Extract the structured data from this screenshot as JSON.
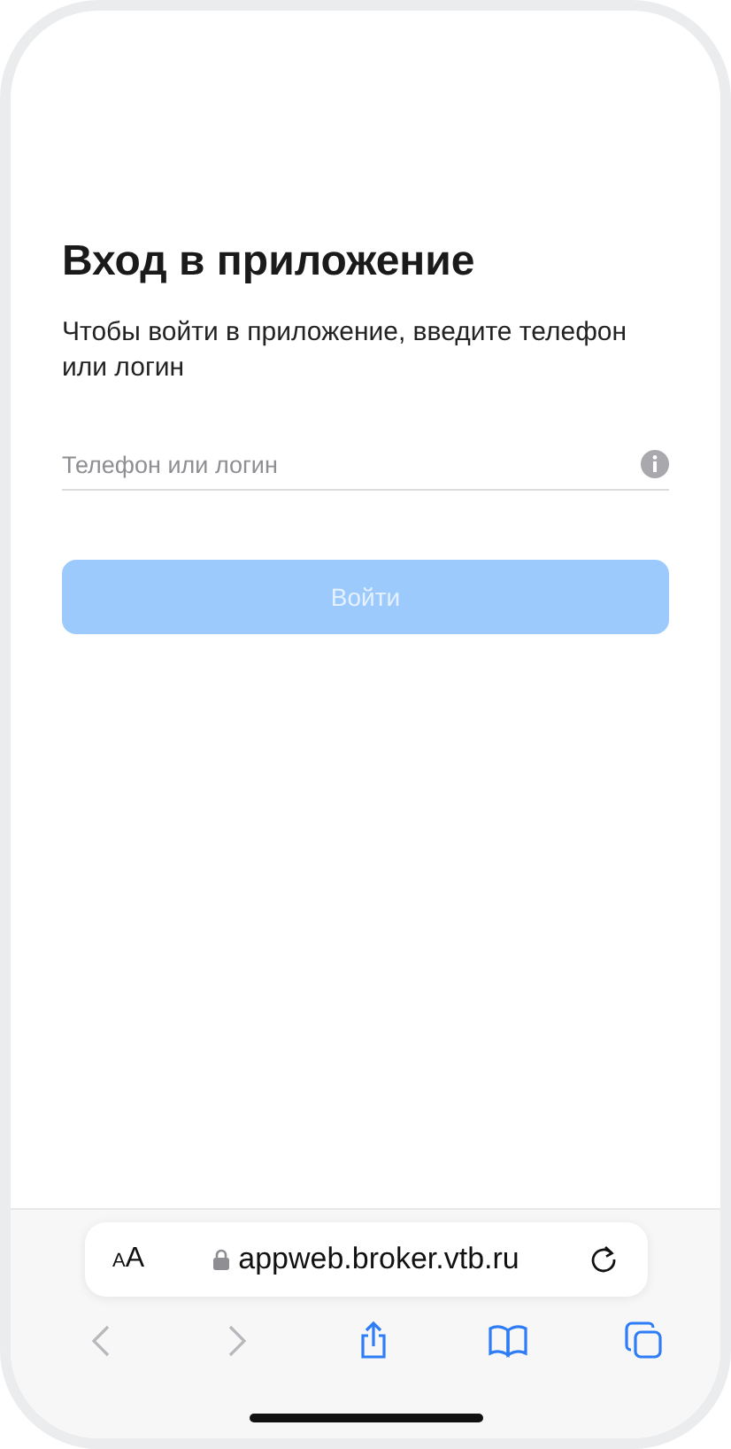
{
  "title": "Вход в приложение",
  "description": "Чтобы войти в приложение, введите телефон или логин",
  "login_field": {
    "placeholder": "Телефон или логин"
  },
  "submit_button": {
    "label": "Войти",
    "disabled": true
  },
  "browser_bar": {
    "text_size_button": "AA",
    "url": "appweb.broker.vtb.ru"
  },
  "toolbar": [
    {
      "kind": "back",
      "disabled": true
    },
    {
      "kind": "forward",
      "disabled": true
    },
    {
      "kind": "share",
      "disabled": false
    },
    {
      "kind": "bookmarks",
      "disabled": false
    },
    {
      "kind": "tabs",
      "disabled": false
    }
  ]
}
